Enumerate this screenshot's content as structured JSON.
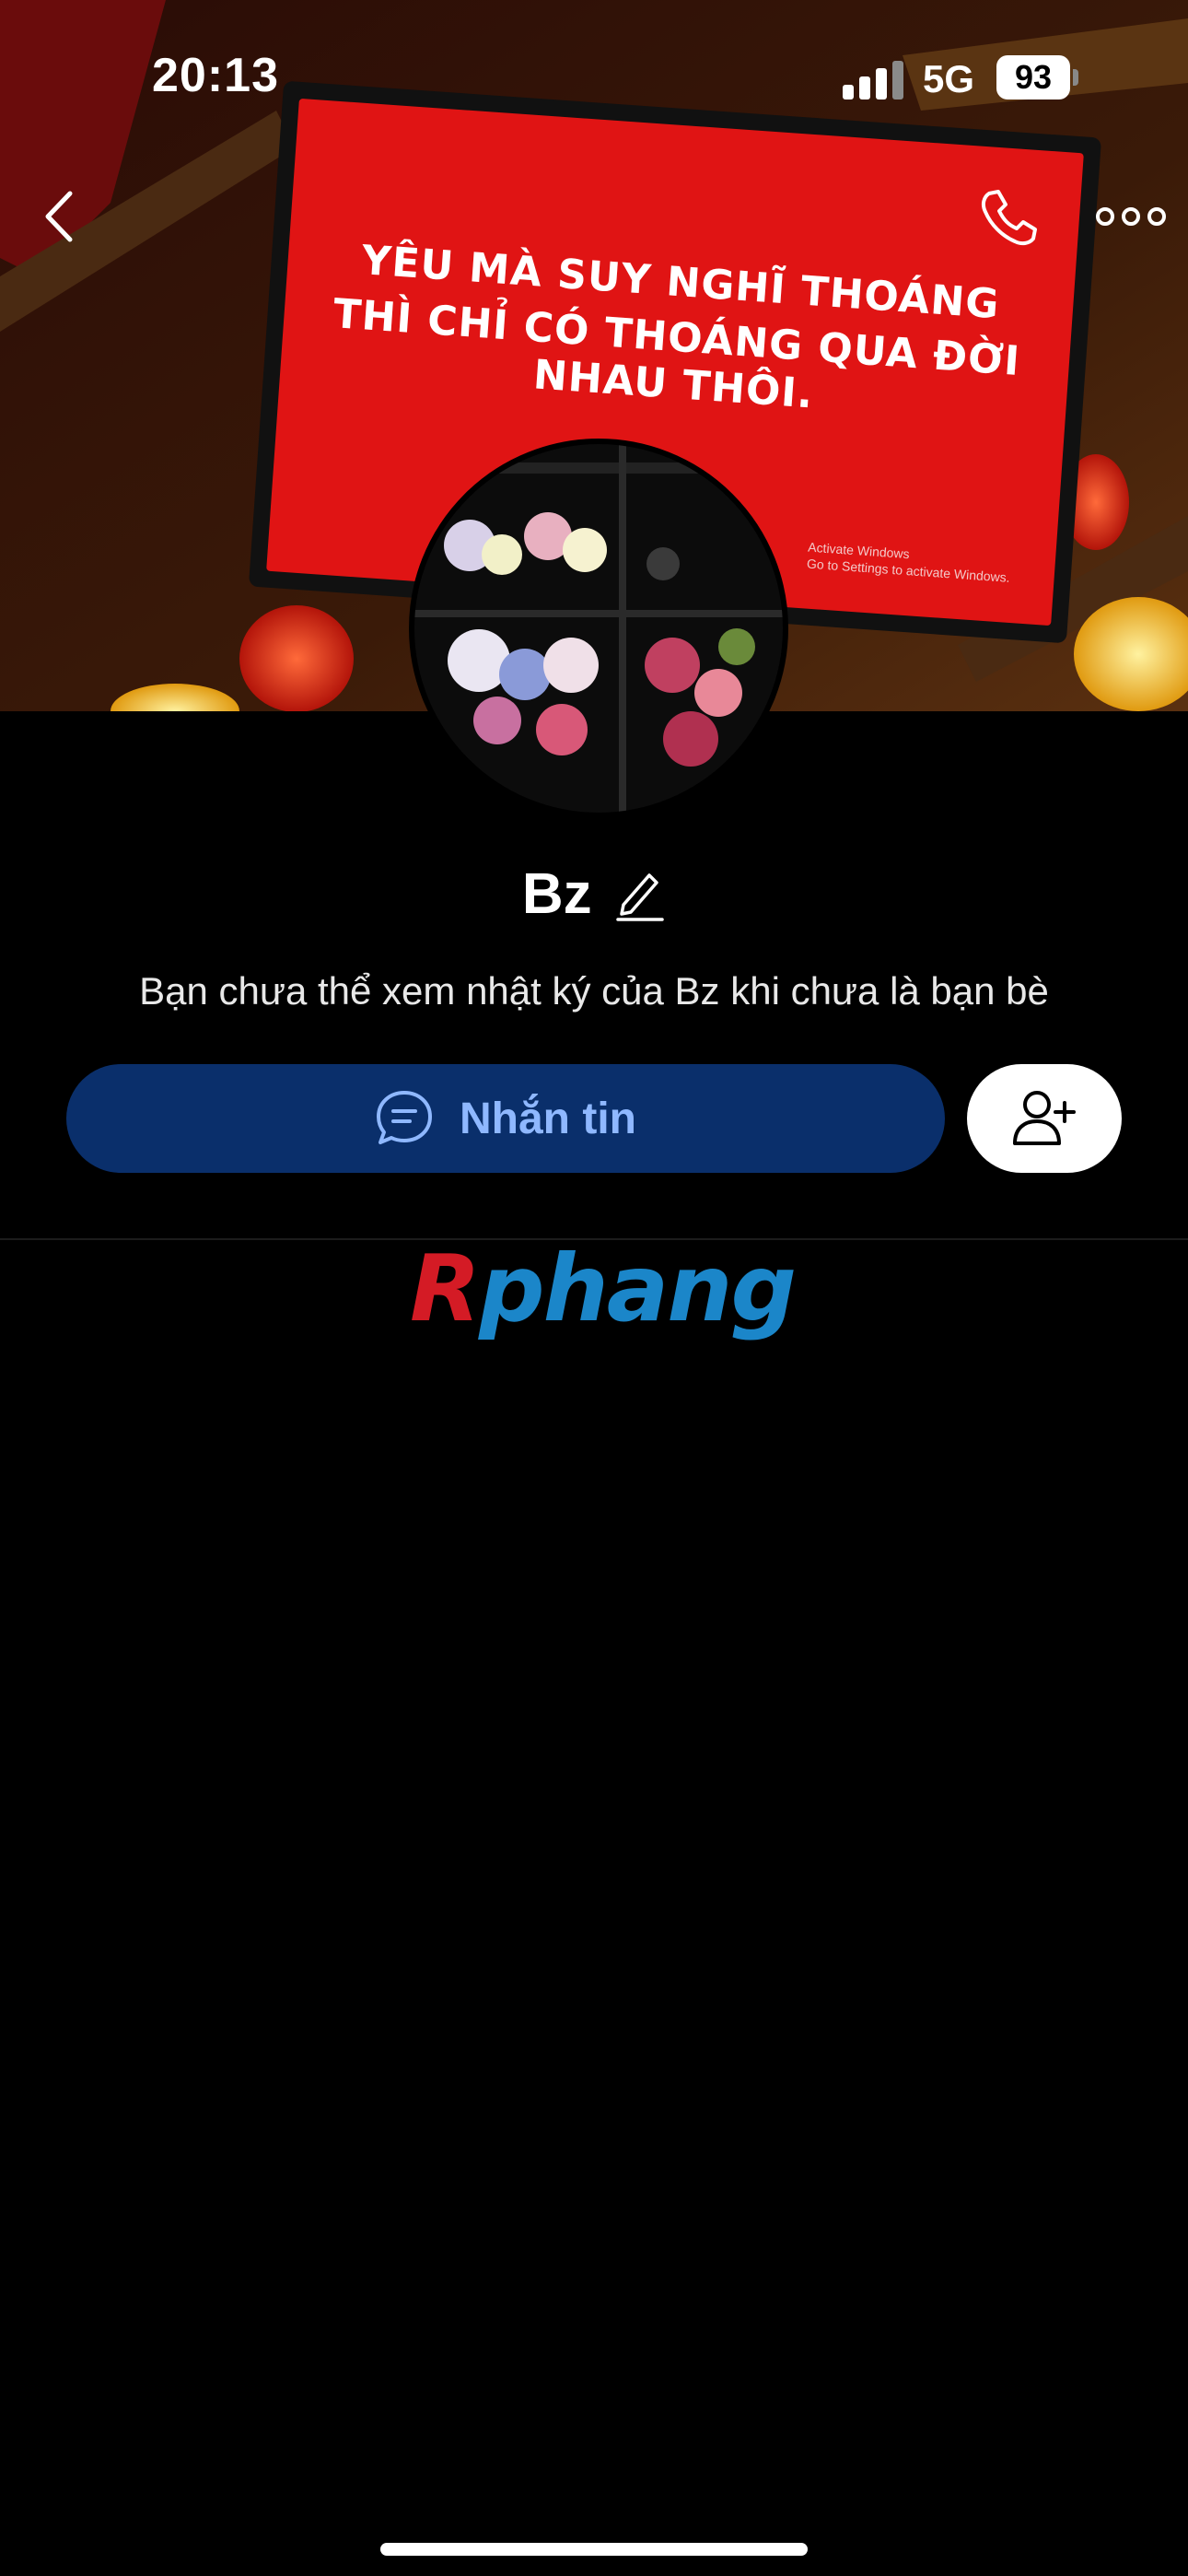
{
  "status_bar": {
    "time": "20:13",
    "network": "5G",
    "battery": "93"
  },
  "cover": {
    "sign_line_1": "YÊU MÀ SUY NGHĨ THOÁNG",
    "sign_line_2": "THÌ CHỈ CÓ THOÁNG QUA ĐỜI NHAU THÔI.",
    "activate_line_1": "Activate Windows",
    "activate_line_2": "Go to Settings to activate Windows."
  },
  "profile": {
    "name": "Bz",
    "privacy_note": "Bạn chưa thể xem nhật ký của Bz khi chưa là bạn bè"
  },
  "actions": {
    "message_label": "Nhắn tin"
  },
  "watermark": {
    "part_a": "R",
    "part_b": "phang"
  },
  "icons": [
    "back-icon",
    "phone-icon",
    "more-icon",
    "edit-pencil-icon",
    "chat-bubble-icon",
    "add-friend-icon"
  ],
  "colors": {
    "background": "#000000",
    "message_button": "#0a2f6b",
    "message_text": "#8fb8ff",
    "sign_red": "#e01414"
  }
}
